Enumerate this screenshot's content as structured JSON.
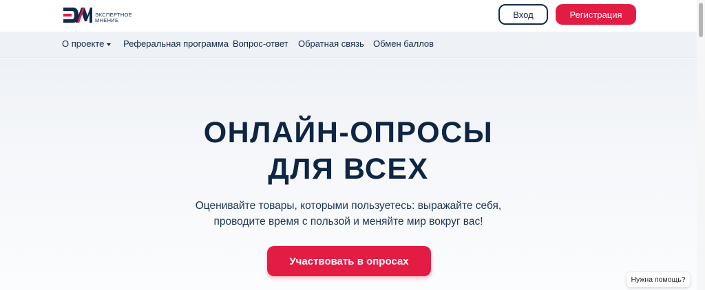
{
  "header": {
    "logo_text_line1": "ЭКСПЕРТНОЕ",
    "logo_text_line2": "МНЕНИЕ",
    "login_label": "Вход",
    "register_label": "Регистрация"
  },
  "nav": {
    "items": [
      {
        "label": "О проекте"
      },
      {
        "label": "Реферальная программа"
      },
      {
        "label": "Вопрос-ответ"
      },
      {
        "label": "Обратная связь"
      },
      {
        "label": "Обмен баллов"
      }
    ]
  },
  "hero": {
    "title_line1": "ОНЛАЙН-ОПРОСЫ",
    "title_line2": "ДЛЯ ВСЕХ",
    "subtitle_line1": "Оценивайте товары, которыми пользуетесь: выражайте себя,",
    "subtitle_line2": "проводите время с пользой и меняйте мир вокруг вас!",
    "cta_label": "Участвовать в опросах"
  },
  "help": {
    "label": "Нужна помощь?"
  },
  "colors": {
    "accent": "#e31c44",
    "navy": "#13294b",
    "nav_bg": "#eef1f6"
  }
}
